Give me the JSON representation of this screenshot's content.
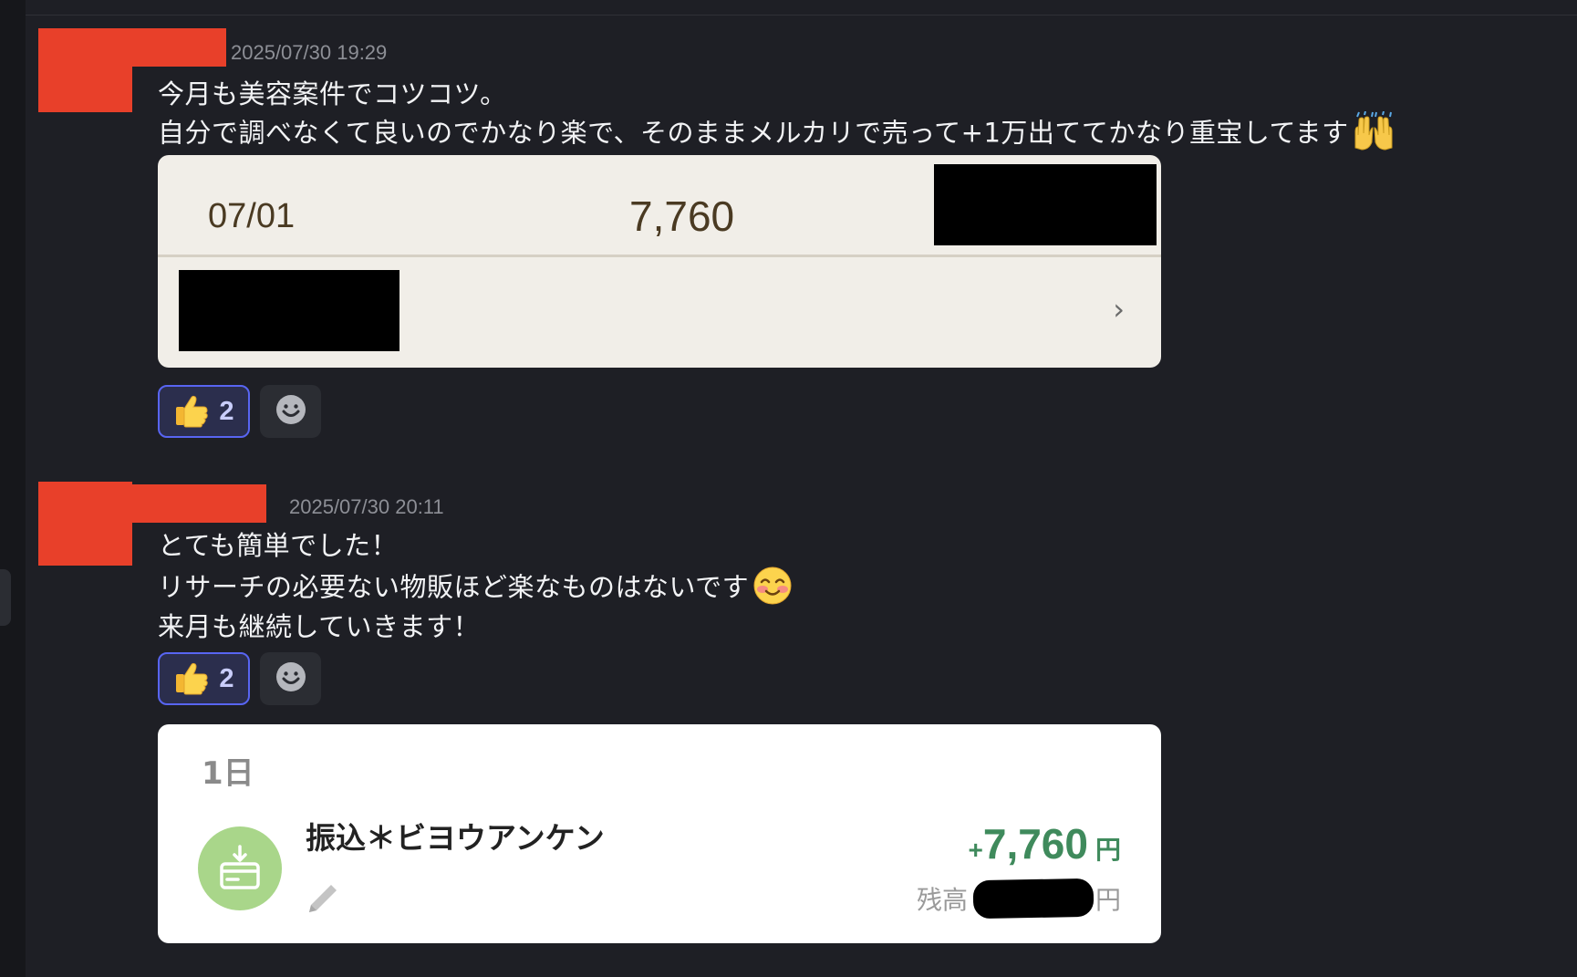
{
  "messages": [
    {
      "timestamp": "2025/07/30 19:29",
      "lines": [
        "今月も美容案件でコツコツ。",
        "自分で調べなくて良いのでかなり楽で、そのままメルカリで売って+1万出ててかなり重宝してます"
      ],
      "trailing_emoji": "raising-hands-emoji",
      "attachment": {
        "date": "07/01",
        "amount": "7,760",
        "chevron": "›"
      },
      "reactions": [
        {
          "emoji": "thumbs-up-emoji",
          "count": "2"
        }
      ]
    },
    {
      "timestamp": "2025/07/30 20:11",
      "lines": [
        "とても簡単でした！",
        "リサーチの必要ない物販ほど楽なものはないです",
        "来月も継続していきます！"
      ],
      "trailing_emoji": "smiling-face-emoji",
      "reactions": [
        {
          "emoji": "thumbs-up-emoji",
          "count": "2"
        }
      ],
      "attachment": {
        "day": "1日",
        "title": "振込＊ビヨウアンケン",
        "amount_sign": "+",
        "amount": "7,760",
        "amount_unit": "円",
        "balance_label": "残高",
        "balance_unit": "円"
      }
    }
  ],
  "colors": {
    "background": "#1e1f25",
    "redaction_red": "#e8402a",
    "reaction_border": "#5865f2",
    "deposit_green": "#3f8a5c",
    "icon_green": "#a9d68a"
  }
}
